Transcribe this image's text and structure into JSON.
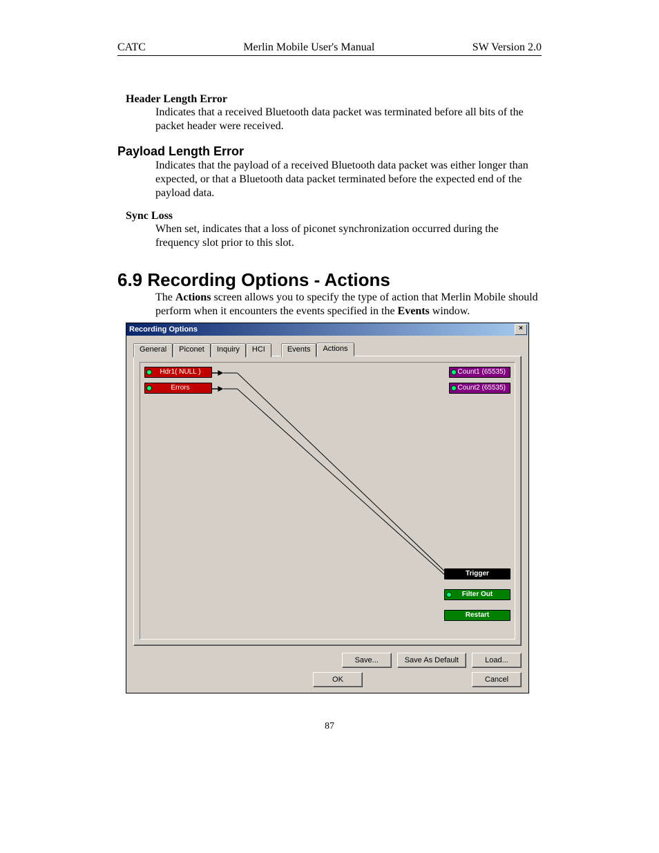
{
  "header": {
    "left": "CATC",
    "center": "Merlin Mobile User's Manual",
    "right": "SW Version 2.0"
  },
  "sections": {
    "hle_title": "Header Length Error",
    "hle_body": "Indicates that a received Bluetooth data packet was terminated before all bits of the packet header were received.",
    "ple_title": "Payload Length Error",
    "ple_body": "Indicates that the payload of a received Bluetooth data packet was either longer than expected, or that a Bluetooth data packet terminated before the expected end of the payload data.",
    "sl_title": "Sync Loss",
    "sl_body": "When set, indicates that a loss of piconet synchronization occurred during the frequency slot prior to this slot.",
    "main_title": "6.9  Recording Options - Actions",
    "main_body_pre": "The ",
    "main_body_bold1": "Actions",
    "main_body_mid": " screen allows you to specify the type of action that Merlin Mobile should perform when it encounters the events specified in the ",
    "main_body_bold2": "Events",
    "main_body_post": " window."
  },
  "dialog": {
    "title": "Recording Options",
    "close": "×",
    "tabs": [
      "General",
      "Piconet",
      "Inquiry",
      "HCI",
      "Events",
      "Actions"
    ],
    "active_tab": "Actions",
    "nodes": {
      "hdr1": "Hdr1( NULL )",
      "errors": "Errors",
      "count1": "Count1 (65535)",
      "count2": "Count2 (65535)",
      "trigger": "Trigger",
      "filterout": "Filter Out",
      "restart": "Restart"
    },
    "buttons": {
      "save": "Save...",
      "save_default": "Save As Default",
      "load": "Load...",
      "ok": "OK",
      "cancel": "Cancel"
    }
  },
  "page_number": "87"
}
